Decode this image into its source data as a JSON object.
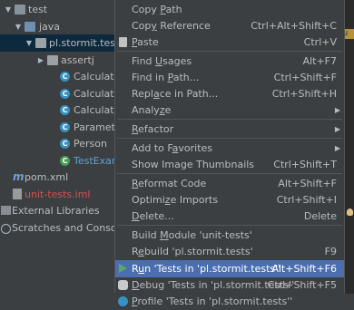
{
  "tree": {
    "items": [
      {
        "label": "test"
      },
      {
        "label": "java"
      },
      {
        "label": "pl.stormit.tes"
      },
      {
        "label": "assertj"
      },
      {
        "label": "Calculator"
      },
      {
        "label": "Calculator"
      },
      {
        "label": "Calculator"
      },
      {
        "label": "Parameter"
      },
      {
        "label": "Person"
      },
      {
        "label": "TestExamp"
      },
      {
        "label": "pom.xml"
      },
      {
        "label": "unit-tests.iml"
      },
      {
        "label": "External Libraries"
      },
      {
        "label": "Scratches and Consoles"
      }
    ],
    "maven_glyph": "m",
    "class_glyph": "C"
  },
  "editor": {
    "highlight_text": "ou"
  },
  "menu": {
    "copy_path": {
      "pre": "Copy ",
      "u": "P",
      "post": "ath",
      "shortcut": ""
    },
    "copy_reference": {
      "pre": "Cop",
      "u": "y",
      "post": " Reference",
      "shortcut": "Ctrl+Alt+Shift+C"
    },
    "paste": {
      "pre": "",
      "u": "P",
      "post": "aste",
      "shortcut": "Ctrl+V"
    },
    "find_usages": {
      "pre": "Find ",
      "u": "U",
      "post": "sages",
      "shortcut": "Alt+F7"
    },
    "find_in_path": {
      "pre": "Find in ",
      "u": "P",
      "post": "ath...",
      "shortcut": "Ctrl+Shift+F"
    },
    "replace_in_path": {
      "pre": "Repl",
      "u": "a",
      "post": "ce in Path...",
      "shortcut": "Ctrl+Shift+H"
    },
    "analyze": {
      "pre": "Analy",
      "u": "z",
      "post": "e"
    },
    "refactor": {
      "pre": "",
      "u": "R",
      "post": "efactor"
    },
    "add_to_favorites": {
      "pre": "Add to F",
      "u": "a",
      "post": "vorites"
    },
    "show_thumbnails": {
      "pre": "Show Image Thumbnails",
      "u": "",
      "post": "",
      "shortcut": "Ctrl+Shift+T"
    },
    "reformat_code": {
      "pre": "",
      "u": "R",
      "post": "eformat Code",
      "shortcut": "Alt+Shift+F"
    },
    "optimize_imports": {
      "pre": "Optimi",
      "u": "z",
      "post": "e Imports",
      "shortcut": "Ctrl+Shift+I"
    },
    "delete": {
      "pre": "",
      "u": "D",
      "post": "elete...",
      "shortcut": "Delete"
    },
    "build_module": {
      "pre": "Build ",
      "u": "M",
      "post": "odule 'unit-tests'",
      "shortcut": ""
    },
    "rebuild": {
      "pre": "R",
      "u": "e",
      "post": "build 'pl.stormit.tests'",
      "shortcut": "F9"
    },
    "run_tests": {
      "pre": "R",
      "u": "u",
      "post": "n 'Tests in 'pl.stormit.tests''",
      "shortcut": "Alt+Shift+F6"
    },
    "debug_tests": {
      "pre": "",
      "u": "D",
      "post": "ebug 'Tests in 'pl.stormit.tests''",
      "shortcut": "Ctrl+Shift+F5"
    },
    "profile_tests": {
      "pre": "",
      "u": "P",
      "post": "rofile 'Tests in 'pl.stormit.tests''",
      "shortcut": ""
    }
  }
}
